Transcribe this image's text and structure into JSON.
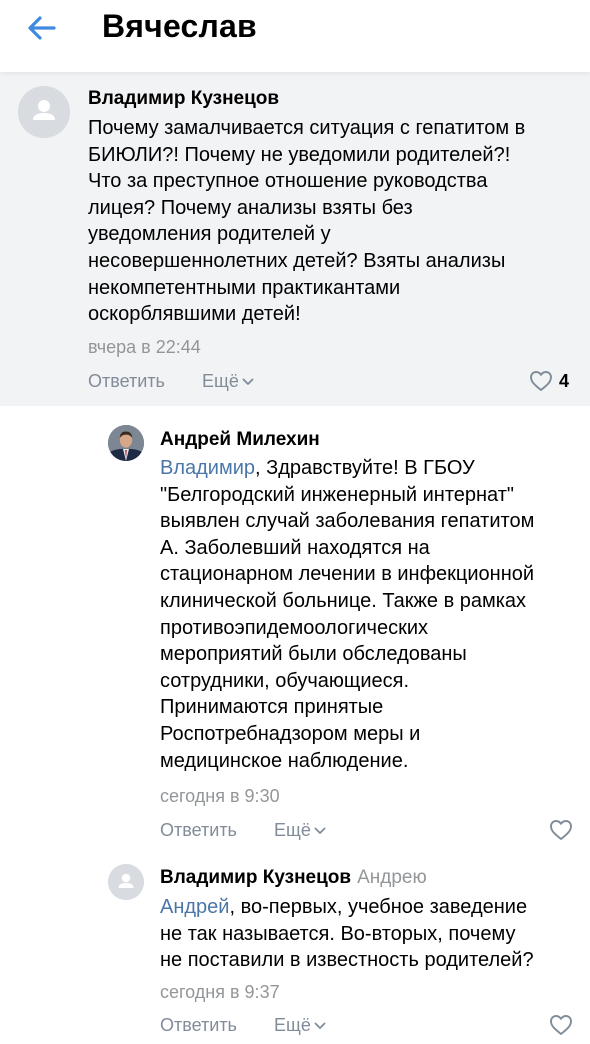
{
  "header": {
    "title": "Вячеслав"
  },
  "comments": [
    {
      "author": "Владимир Кузнецов",
      "text_lines": [
        "Почему замалчивается ситуация с гепатитом в",
        "БИЮЛИ?! Почему не уведомили родителей?!",
        "Что за преступное отношение руководства",
        "лицея? Почему анализы взяты без",
        "уведомления родителей у",
        "несовершеннолетних детей? Взяты анализы",
        "некомпетентными практикантами",
        "оскорблявшими детей!"
      ],
      "time": "вчера в 22:44",
      "reply_label": "Ответить",
      "more_label": "Ещё",
      "likes": "4"
    },
    {
      "author": "Андрей Милехин",
      "mention": "Владимир",
      "text_first_rest": ", Здравствуйте! В ГБОУ",
      "text_lines": [
        "\"Белгородский инженерный интернат\"",
        "выявлен случай заболевания гепатитом",
        "А. Заболевший находятся на",
        "стационарном лечении в инфекционной",
        "клинической больнице. Также в рамках",
        "противоэпидемоологических",
        "мероприятий были обследованы",
        "сотрудники, обучающиеся.",
        "Принимаются принятые",
        "Роспотребнадзором меры и",
        "медицинское наблюдение."
      ],
      "time": "сегодня в 9:30",
      "reply_label": "Ответить",
      "more_label": "Ещё"
    },
    {
      "author": "Владимир Кузнецов",
      "reply_to": "Андрею",
      "mention": "Андрей",
      "text_first_rest": ", во-первых, учебное заведение",
      "text_lines": [
        "не так называется. Во-вторых, почему",
        "не поставили в известность родителей?"
      ],
      "time": "сегодня в 9:37",
      "reply_label": "Ответить",
      "more_label": "Ещё"
    }
  ],
  "icons": {
    "back": "arrow-left-icon",
    "like": "heart-outline-icon",
    "chevron": "chevron-down-icon",
    "default_avatar": "user-silhouette-icon"
  },
  "colors": {
    "accent": "#4a76a8",
    "back_arrow": "#3f8ae0",
    "secondary_text": "#939699",
    "action_text": "#818c99",
    "highlight_bg": "#f2f3f5"
  }
}
